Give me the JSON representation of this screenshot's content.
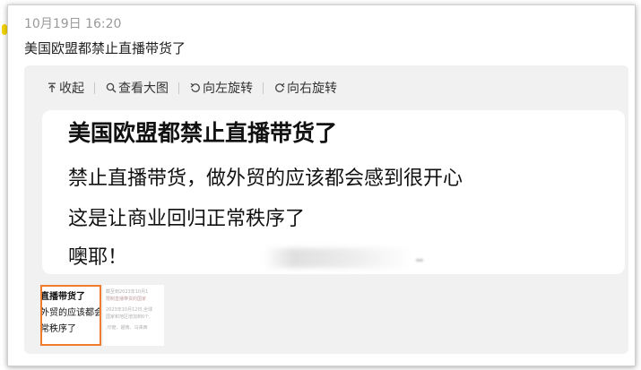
{
  "post": {
    "timestamp": "10月19日 16:20",
    "title": "美国欧盟都禁止直播带货了"
  },
  "toolbar": {
    "collapse_label": "收起",
    "view_large_label": "查看大图",
    "rotate_left_label": "向左旋转",
    "rotate_right_label": "向右旋转"
  },
  "image_text": {
    "lines": [
      "美国欧盟都禁止直播带货了",
      "禁止直播带货，做外贸的应该都会感到很开心",
      "这是让商业回归正常秩序了",
      "噢耶！"
    ]
  },
  "thumbnails": [
    {
      "lines": [
        "直播带货了",
        "外贸的应该都会",
        "常秩序了"
      ]
    },
    {
      "lines": [
        "截至到2023年10月1",
        "限制直播带货的国家",
        "2023年10月12日,全球",
        "国家和地区增加到6个,",
        ",印度、越南、马来西"
      ]
    }
  ],
  "colors": {
    "thumb_selected_border": "#f07d2f",
    "viewer_bg": "#f1f1f1",
    "indicator": "#f6d400"
  }
}
